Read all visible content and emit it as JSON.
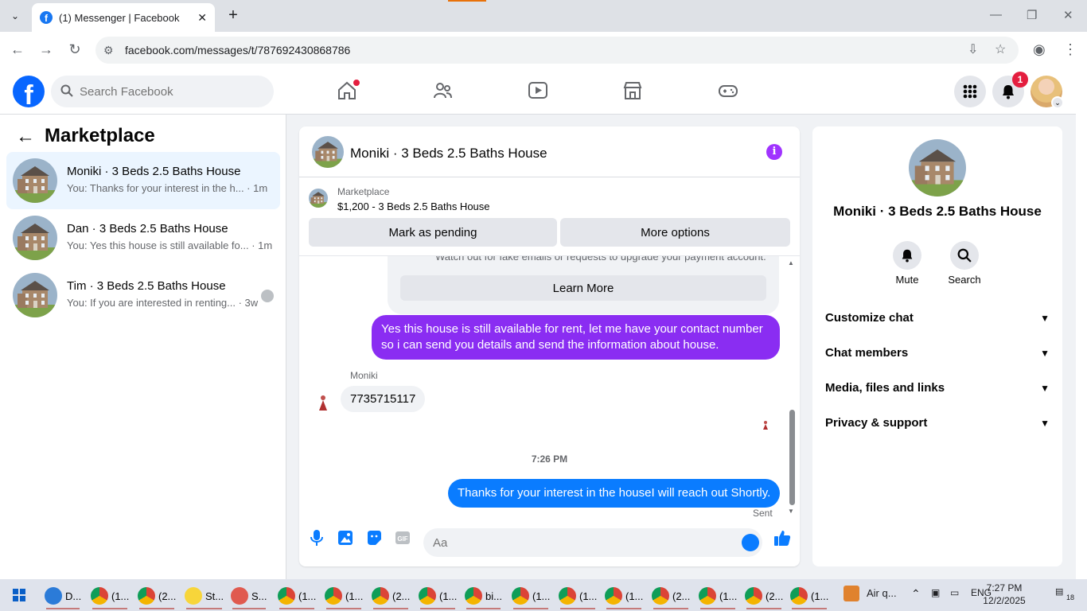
{
  "browser": {
    "tab_title": "(1) Messenger | Facebook",
    "url": "facebook.com/messages/t/787692430868786"
  },
  "fb": {
    "search_placeholder": "Search Facebook",
    "notification_count": "1"
  },
  "left": {
    "title": "Marketplace",
    "conversations": [
      {
        "name": "Moniki · 3 Beds 2.5 Baths House",
        "preview": "You: Thanks for your interest in the h... · 1m",
        "active": true
      },
      {
        "name": "Dan · 3 Beds 2.5 Baths House",
        "preview": "You: Yes this house is still available fo... · 1m",
        "active": false
      },
      {
        "name": "Tim · 3 Beds 2.5 Baths House",
        "preview": "You: If you are interested in renting... · 3w",
        "active": false
      }
    ]
  },
  "chat": {
    "title": "Moniki · 3 Beds 2.5 Baths House",
    "listing_label": "Marketplace",
    "listing_price": "$1,200 - 3 Beds 2.5 Baths House",
    "mark_pending_label": "Mark as pending",
    "more_options_label": "More options",
    "warning_text": "Watch out for fake emails or requests to upgrade your payment account.",
    "learn_more_label": "Learn More",
    "msg_out_1": "Yes this house is still available for rent, let me have your contact number so i can send you details and send the information about house.",
    "sender_name": "Moniki",
    "msg_in_1": "7735715117",
    "timestamp": "7:26 PM",
    "msg_out_2": "Thanks for your interest in the houseI will reach out Shortly.",
    "sent_label": "Sent",
    "composer_placeholder": "Aa"
  },
  "right": {
    "title": "Moniki · 3 Beds 2.5 Baths House",
    "mute_label": "Mute",
    "search_label": "Search",
    "sections": [
      "Customize chat",
      "Chat members",
      "Media, files and links",
      "Privacy & support"
    ]
  },
  "taskbar": {
    "items": [
      {
        "label": "D...",
        "icon": "download-icon"
      },
      {
        "label": "(1...",
        "icon": "chrome-icon"
      },
      {
        "label": "(2...",
        "icon": "chrome-icon"
      },
      {
        "label": "St...",
        "icon": "sticky-notes-icon"
      },
      {
        "label": "S...",
        "icon": "snipping-tool-icon"
      },
      {
        "label": "(1...",
        "icon": "chrome-icon"
      },
      {
        "label": "(1...",
        "icon": "chrome-icon"
      },
      {
        "label": "(2...",
        "icon": "chrome-icon"
      },
      {
        "label": "(1...",
        "icon": "chrome-icon"
      },
      {
        "label": "bi...",
        "icon": "chrome-icon"
      },
      {
        "label": "(1...",
        "icon": "chrome-icon"
      },
      {
        "label": "(1...",
        "icon": "chrome-icon"
      },
      {
        "label": "(1...",
        "icon": "chrome-icon"
      },
      {
        "label": "(2...",
        "icon": "chrome-icon"
      },
      {
        "label": "(1...",
        "icon": "chrome-icon"
      },
      {
        "label": "(2...",
        "icon": "chrome-icon"
      },
      {
        "label": "(1...",
        "icon": "chrome-icon"
      }
    ],
    "weather": "Air q...",
    "language": "ENG",
    "time": "7:27 PM",
    "date": "12/2/2025",
    "notification_count": "18"
  },
  "colors": {
    "fb_blue": "#0866ff",
    "outgoing_bubble": "#8a2df2",
    "outgoing_bubble_2": "#0a7cff",
    "active_conv_bg": "#ebf5ff",
    "badge_red": "#e41e3f"
  }
}
